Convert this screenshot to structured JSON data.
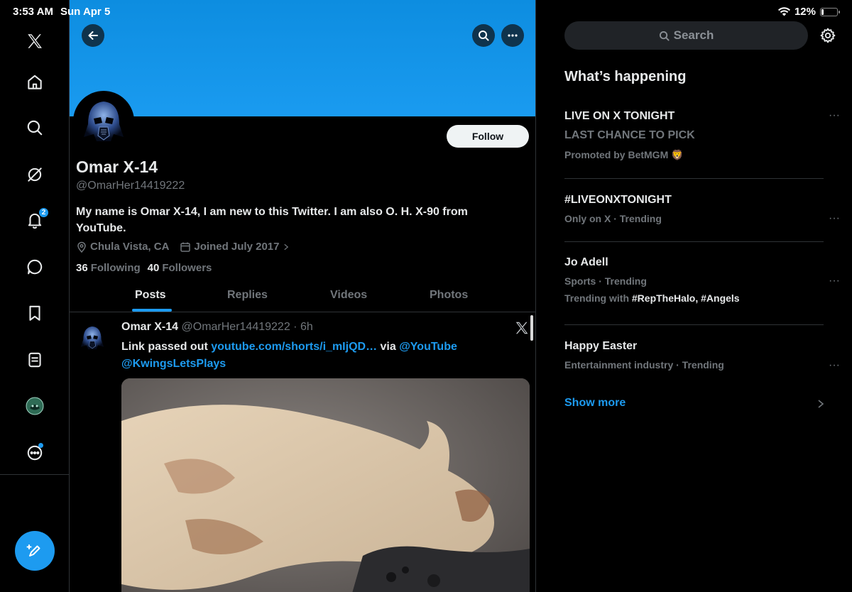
{
  "status_bar": {
    "time": "3:53 AM",
    "date": "Sun Apr 5",
    "battery_text": "12%",
    "battery_level": 0.12
  },
  "nav": {
    "items": [
      "x-logo",
      "home",
      "explore",
      "grok",
      "notifications",
      "messages",
      "bookmarks",
      "lists",
      "profile",
      "more"
    ],
    "notifications_badge": "2"
  },
  "profile": {
    "display_name": "Omar X-14",
    "handle": "@OmarHer14419222",
    "bio": "My name is Omar X-14, I am new to this Twitter. I am also O. H. X-90 from YouTube.",
    "location": "Chula Vista, CA",
    "joined": "Joined July 2017",
    "following_count": "36",
    "following_label": "Following",
    "followers_count": "40",
    "followers_label": "Followers",
    "follow_label": "Follow"
  },
  "tabs": [
    {
      "label": "Posts",
      "active": true
    },
    {
      "label": "Replies",
      "active": false
    },
    {
      "label": "Videos",
      "active": false
    },
    {
      "label": "Photos",
      "active": false
    }
  ],
  "post": {
    "name": "Omar X-14",
    "handle": "@OmarHer14419222",
    "sep": "·",
    "time": "6h",
    "text_prefix": "Link passed out ",
    "link": "youtube.com/shorts/i_mIjQD…",
    "text_mid": " via ",
    "mention1": "@YouTube",
    "mention2": "@KwingsLetsPlays"
  },
  "sidebar": {
    "search_placeholder": "Search",
    "title": "What’s happening",
    "trends": [
      {
        "line1": "LIVE ON X TONIGHT",
        "line2": "LAST CHANCE TO PICK",
        "line3": "Promoted by BetMGM 🦁"
      },
      {
        "line1": "#LIVEONXTONIGHT",
        "line2": "Only on X · Trending"
      },
      {
        "line1": "Jo Adell",
        "line2": "Sports · Trending",
        "line3_prefix": "Trending with ",
        "line3_tags": "#RepTheHalo, #Angels"
      },
      {
        "line1": "Happy Easter",
        "line2": "Entertainment industry · Trending"
      }
    ],
    "show_more": "Show more"
  },
  "colors": {
    "accent": "#1d9bf0",
    "banner": "#1a9bf0",
    "text": "#e7e9ea",
    "muted": "#71767b"
  }
}
